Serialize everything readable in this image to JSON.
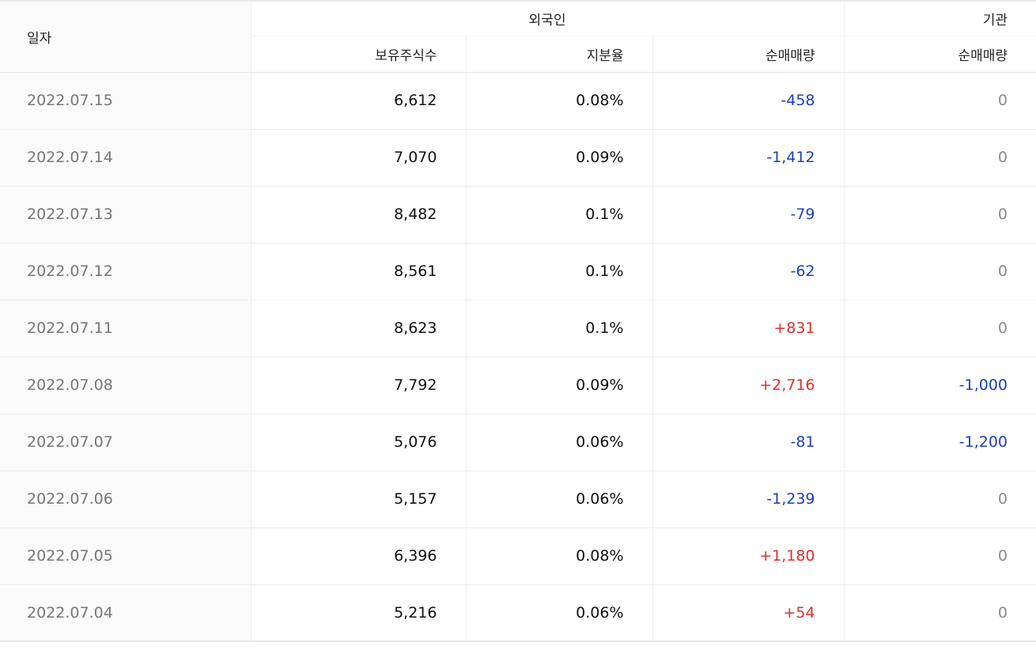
{
  "headers": {
    "date": "일자",
    "foreign_group": "외국인",
    "institution_group": "기관",
    "holdings": "보유주식수",
    "ratio": "지분율",
    "foreign_net": "순매매량",
    "institution_net": "순매매량"
  },
  "rows": [
    {
      "date": "2022.07.15",
      "holdings": "6,612",
      "ratio": "0.08%",
      "foreign_net": "-458",
      "institution_net": "0"
    },
    {
      "date": "2022.07.14",
      "holdings": "7,070",
      "ratio": "0.09%",
      "foreign_net": "-1,412",
      "institution_net": "0"
    },
    {
      "date": "2022.07.13",
      "holdings": "8,482",
      "ratio": "0.1%",
      "foreign_net": "-79",
      "institution_net": "0"
    },
    {
      "date": "2022.07.12",
      "holdings": "8,561",
      "ratio": "0.1%",
      "foreign_net": "-62",
      "institution_net": "0"
    },
    {
      "date": "2022.07.11",
      "holdings": "8,623",
      "ratio": "0.1%",
      "foreign_net": "+831",
      "institution_net": "0"
    },
    {
      "date": "2022.07.08",
      "holdings": "7,792",
      "ratio": "0.09%",
      "foreign_net": "+2,716",
      "institution_net": "-1,000"
    },
    {
      "date": "2022.07.07",
      "holdings": "5,076",
      "ratio": "0.06%",
      "foreign_net": "-81",
      "institution_net": "-1,200"
    },
    {
      "date": "2022.07.06",
      "holdings": "5,157",
      "ratio": "0.06%",
      "foreign_net": "-1,239",
      "institution_net": "0"
    },
    {
      "date": "2022.07.05",
      "holdings": "6,396",
      "ratio": "0.08%",
      "foreign_net": "+1,180",
      "institution_net": "0"
    },
    {
      "date": "2022.07.04",
      "holdings": "5,216",
      "ratio": "0.06%",
      "foreign_net": "+54",
      "institution_net": "0"
    }
  ],
  "colors": {
    "negative": "#1d3fbb",
    "positive": "#e0302c",
    "neutral": "#8a8a8a"
  }
}
